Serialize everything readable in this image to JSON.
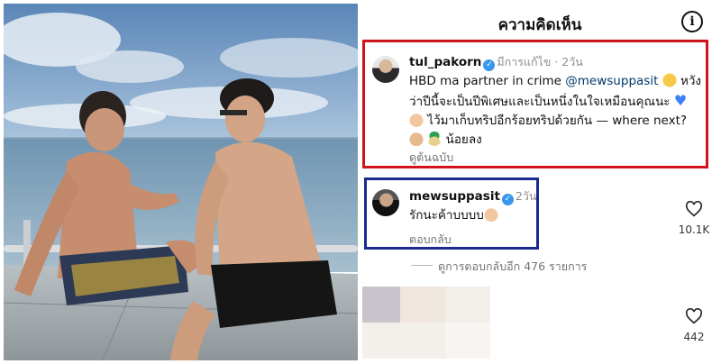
{
  "header": {
    "title": "ความคิดเห็น",
    "info_icon": "info-icon"
  },
  "comments": [
    {
      "username": "tul_pakorn",
      "verified": true,
      "edited_label": "มีการแก้ไข",
      "time": "2วัน",
      "text_1": "HBD ma partner in crime ",
      "mention": "@mewsuppasit",
      "text_2": " หวัง",
      "line_2": "ว่าปีนี้จะเป็นปีพิเศษและเป็นหนึ่งในใจเหมือนคุณนะ ",
      "line_3": " ไว้มาเก็บทริปอีกร้อยทริปด้วยกัน — where next?",
      "line_4": "น้อยลง",
      "translate": "ดูต้นฉบับ",
      "emojis": [
        "crying-face",
        "blue-heart",
        "heart-hands",
        "thumbs-up",
        "island"
      ],
      "highlight_color": "#d0141e"
    },
    {
      "username": "mewsuppasit",
      "verified": true,
      "time": "2วัน",
      "text": "รักนะค้าบบบบ",
      "reply": "ตอบกลับ",
      "likes": "10.1K",
      "emojis": [
        "heart-hands"
      ],
      "highlight_color": "#1b2a8f"
    }
  ],
  "view_replies": "ดูการตอบกลับอีก 476 รายการ",
  "third_comment": {
    "likes": "442"
  }
}
